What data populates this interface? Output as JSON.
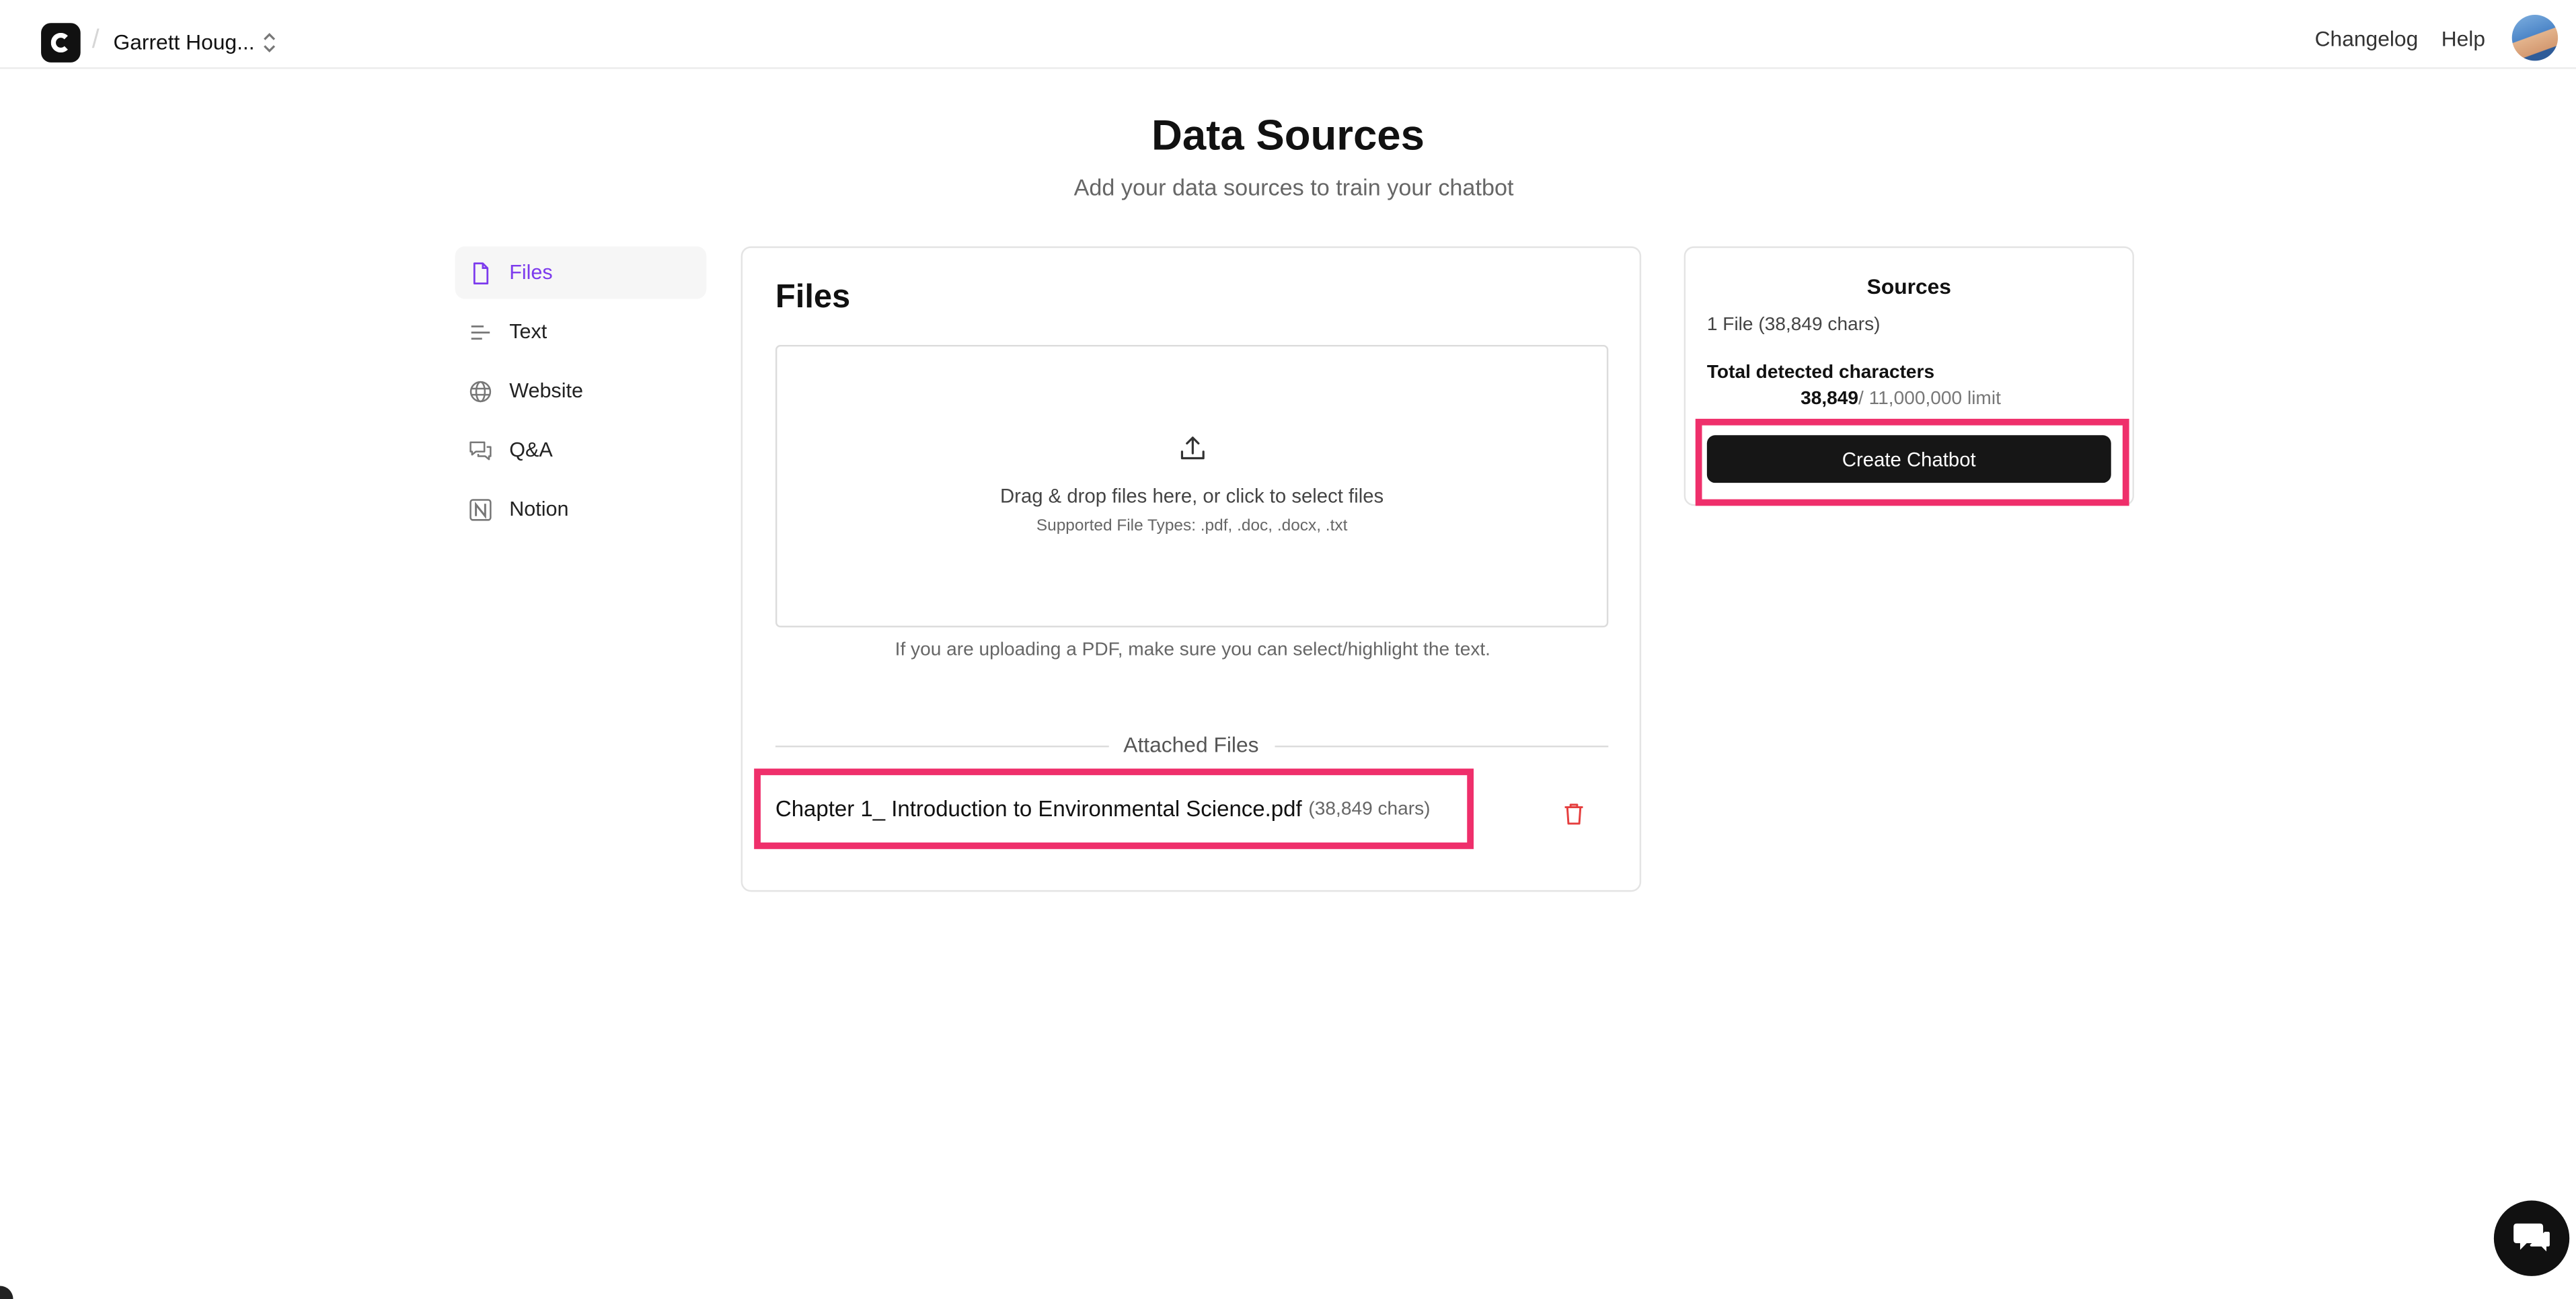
{
  "header": {
    "workspace_name": "Garrett Houg...",
    "changelog_label": "Changelog",
    "help_label": "Help"
  },
  "page": {
    "title": "Data Sources",
    "subtitle": "Add your data sources to train your chatbot"
  },
  "sidebar": {
    "items": [
      {
        "label": "Files",
        "icon": "file-icon",
        "active": true
      },
      {
        "label": "Text",
        "icon": "text-lines-icon",
        "active": false
      },
      {
        "label": "Website",
        "icon": "globe-icon",
        "active": false
      },
      {
        "label": "Q&A",
        "icon": "chat-bubbles-icon",
        "active": false
      },
      {
        "label": "Notion",
        "icon": "notion-icon",
        "active": false
      }
    ]
  },
  "files_panel": {
    "title": "Files",
    "dropzone_text": "Drag & drop files here, or click to select files",
    "dropzone_subtext": "Supported File Types: .pdf, .doc, .docx, .txt",
    "pdf_note": "If you are uploading a PDF, make sure you can select/highlight the text.",
    "attached_label": "Attached Files",
    "attached_files": [
      {
        "name": "Chapter 1_ Introduction to Environmental Science.pdf",
        "chars": "(38,849 chars)"
      }
    ]
  },
  "sources_panel": {
    "title": "Sources",
    "file_count": "1 File (38,849 chars)",
    "total_label": "Total detected characters",
    "total_value": "38,849",
    "limit_text": "/ 11,000,000 limit",
    "create_button": "Create Chatbot"
  },
  "colors": {
    "accent": "#7c3aed",
    "highlight": "#ef2f6b",
    "danger": "#e53e3e",
    "button_bg": "#161616"
  }
}
